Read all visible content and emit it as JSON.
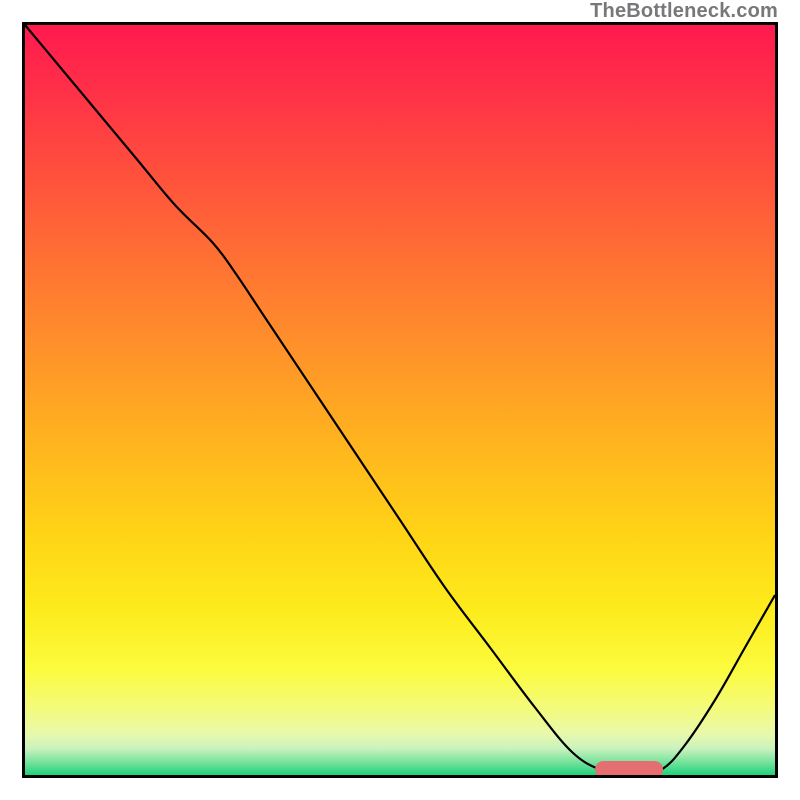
{
  "watermark": "TheBottleneck.com",
  "colors": {
    "border": "#000000",
    "curve": "#000000",
    "marker": "#e56f70",
    "gradient_stops": [
      {
        "offset": 0.0,
        "color": "#ff1a4e"
      },
      {
        "offset": 0.08,
        "color": "#ff2e49"
      },
      {
        "offset": 0.18,
        "color": "#ff4b3e"
      },
      {
        "offset": 0.3,
        "color": "#ff6d34"
      },
      {
        "offset": 0.42,
        "color": "#ff8e2b"
      },
      {
        "offset": 0.55,
        "color": "#ffb21f"
      },
      {
        "offset": 0.68,
        "color": "#ffd416"
      },
      {
        "offset": 0.78,
        "color": "#fdeb1c"
      },
      {
        "offset": 0.86,
        "color": "#fbfb3e"
      },
      {
        "offset": 0.91,
        "color": "#f4fb7a"
      },
      {
        "offset": 0.945,
        "color": "#e8f9ac"
      },
      {
        "offset": 0.965,
        "color": "#c9f2bd"
      },
      {
        "offset": 0.982,
        "color": "#7be39e"
      },
      {
        "offset": 1.0,
        "color": "#1dd37a"
      }
    ]
  },
  "chart_data": {
    "type": "line",
    "title": "",
    "xlabel": "",
    "ylabel": "",
    "xlim": [
      0,
      100
    ],
    "ylim": [
      0,
      100
    ],
    "series": [
      {
        "name": "bottleneck-curve",
        "x": [
          0,
          5,
          10,
          15,
          20,
          25,
          28,
          32,
          38,
          44,
          50,
          56,
          62,
          68,
          73,
          77,
          80,
          82,
          85,
          88,
          92,
          96,
          100
        ],
        "values": [
          100,
          94,
          88,
          82,
          76,
          71,
          67,
          61,
          52,
          43,
          34,
          25,
          17,
          9,
          3,
          0.6,
          0.1,
          0.1,
          0.8,
          4,
          10,
          17,
          24
        ]
      }
    ],
    "annotations": [
      {
        "name": "flat-minimum-marker",
        "x_start": 76,
        "x_end": 85,
        "y": 0.8,
        "color": "#e56f70"
      }
    ],
    "background": "vertical-gradient red→orange→yellow→green"
  }
}
